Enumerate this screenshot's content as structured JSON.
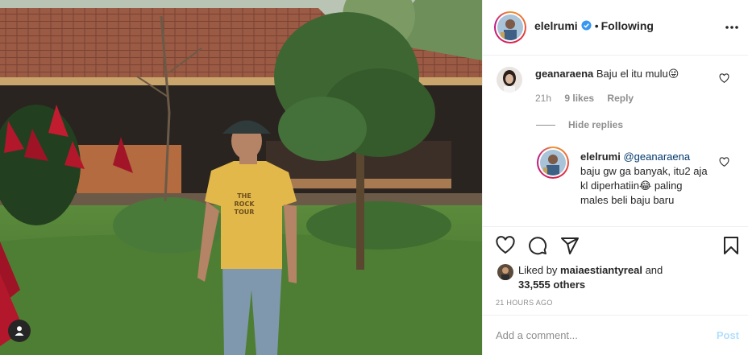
{
  "post": {
    "image_alt": "",
    "photo_shirt_text": [
      "THE",
      "ROCK",
      "TOUR"
    ]
  },
  "header": {
    "username": "elelrumi",
    "separator": "•",
    "follow_status": "Following",
    "verified_icon": "verified-badge-icon",
    "more_icon": "more-options-icon"
  },
  "comments": [
    {
      "username": "geanaraena",
      "text": "Baju el itu mulu",
      "emoji": "😜",
      "time": "21h",
      "likes": "9 likes",
      "reply_label": "Reply",
      "hide_replies_label": "Hide replies"
    }
  ],
  "reply": {
    "username": "elelrumi",
    "mention": "@geanaraena",
    "text": "baju gw ga banyak, itu2 aja kl diperhatiin",
    "emoji": "😂",
    "text2": "paling males beli baju baru"
  },
  "actions": {
    "like_icon": "heart-icon",
    "comment_icon": "comment-bubble-icon",
    "share_icon": "paper-plane-icon",
    "save_icon": "bookmark-icon"
  },
  "likes": {
    "prefix": "Liked by",
    "user": "maiaestiantyreal",
    "connector": "and",
    "count": "33,555 others"
  },
  "timestamp": "21 HOURS AGO",
  "add_comment": {
    "placeholder": "Add a comment...",
    "post_label": "Post"
  },
  "colors": {
    "link_blue": "#0095f6",
    "post_disabled": "#b2dffc",
    "verified_blue": "#3897f0",
    "muted": "#8e8e8e",
    "text": "#262626"
  }
}
